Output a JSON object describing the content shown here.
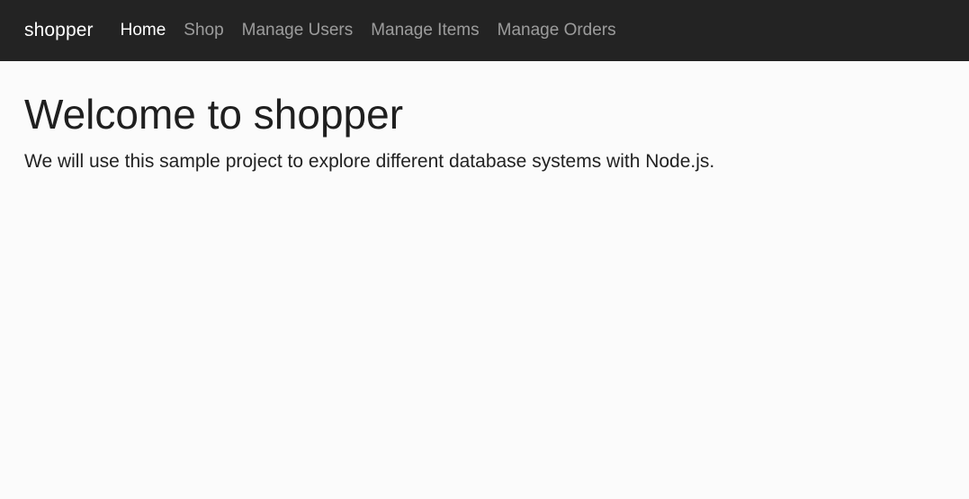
{
  "navbar": {
    "brand": "shopper",
    "items": [
      {
        "label": "Home",
        "active": true
      },
      {
        "label": "Shop",
        "active": false
      },
      {
        "label": "Manage Users",
        "active": false
      },
      {
        "label": "Manage Items",
        "active": false
      },
      {
        "label": "Manage Orders",
        "active": false
      }
    ]
  },
  "main": {
    "title": "Welcome to shopper",
    "lead": "We will use this sample project to explore different database systems with Node.js."
  },
  "colors": {
    "navbar_bg": "#232323",
    "page_bg": "#fbfbfb",
    "nav_active": "#ffffff",
    "nav_inactive": "rgba(255,255,255,0.55)"
  }
}
